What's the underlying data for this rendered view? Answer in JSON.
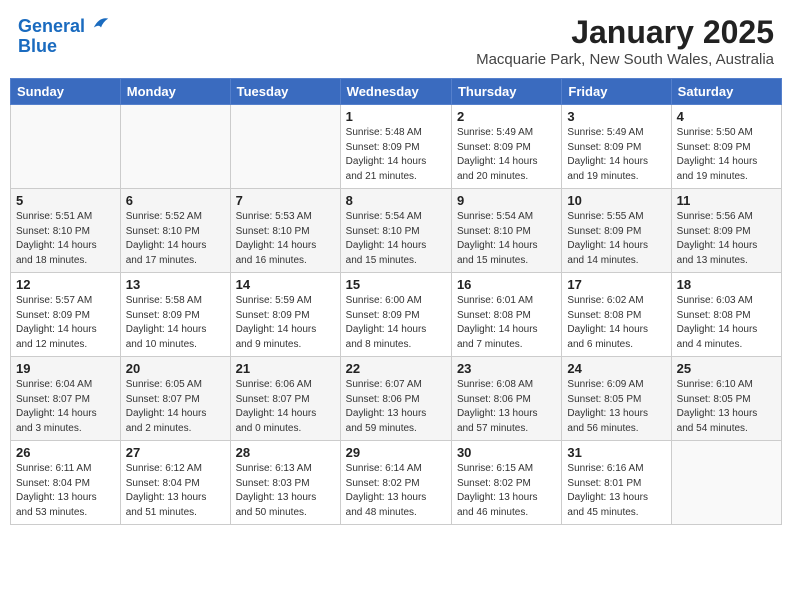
{
  "header": {
    "logo_line1": "General",
    "logo_line2": "Blue",
    "month": "January 2025",
    "location": "Macquarie Park, New South Wales, Australia"
  },
  "weekdays": [
    "Sunday",
    "Monday",
    "Tuesday",
    "Wednesday",
    "Thursday",
    "Friday",
    "Saturday"
  ],
  "weeks": [
    [
      {
        "day": "",
        "info": ""
      },
      {
        "day": "",
        "info": ""
      },
      {
        "day": "",
        "info": ""
      },
      {
        "day": "1",
        "info": "Sunrise: 5:48 AM\nSunset: 8:09 PM\nDaylight: 14 hours\nand 21 minutes."
      },
      {
        "day": "2",
        "info": "Sunrise: 5:49 AM\nSunset: 8:09 PM\nDaylight: 14 hours\nand 20 minutes."
      },
      {
        "day": "3",
        "info": "Sunrise: 5:49 AM\nSunset: 8:09 PM\nDaylight: 14 hours\nand 19 minutes."
      },
      {
        "day": "4",
        "info": "Sunrise: 5:50 AM\nSunset: 8:09 PM\nDaylight: 14 hours\nand 19 minutes."
      }
    ],
    [
      {
        "day": "5",
        "info": "Sunrise: 5:51 AM\nSunset: 8:10 PM\nDaylight: 14 hours\nand 18 minutes."
      },
      {
        "day": "6",
        "info": "Sunrise: 5:52 AM\nSunset: 8:10 PM\nDaylight: 14 hours\nand 17 minutes."
      },
      {
        "day": "7",
        "info": "Sunrise: 5:53 AM\nSunset: 8:10 PM\nDaylight: 14 hours\nand 16 minutes."
      },
      {
        "day": "8",
        "info": "Sunrise: 5:54 AM\nSunset: 8:10 PM\nDaylight: 14 hours\nand 15 minutes."
      },
      {
        "day": "9",
        "info": "Sunrise: 5:54 AM\nSunset: 8:10 PM\nDaylight: 14 hours\nand 15 minutes."
      },
      {
        "day": "10",
        "info": "Sunrise: 5:55 AM\nSunset: 8:09 PM\nDaylight: 14 hours\nand 14 minutes."
      },
      {
        "day": "11",
        "info": "Sunrise: 5:56 AM\nSunset: 8:09 PM\nDaylight: 14 hours\nand 13 minutes."
      }
    ],
    [
      {
        "day": "12",
        "info": "Sunrise: 5:57 AM\nSunset: 8:09 PM\nDaylight: 14 hours\nand 12 minutes."
      },
      {
        "day": "13",
        "info": "Sunrise: 5:58 AM\nSunset: 8:09 PM\nDaylight: 14 hours\nand 10 minutes."
      },
      {
        "day": "14",
        "info": "Sunrise: 5:59 AM\nSunset: 8:09 PM\nDaylight: 14 hours\nand 9 minutes."
      },
      {
        "day": "15",
        "info": "Sunrise: 6:00 AM\nSunset: 8:09 PM\nDaylight: 14 hours\nand 8 minutes."
      },
      {
        "day": "16",
        "info": "Sunrise: 6:01 AM\nSunset: 8:08 PM\nDaylight: 14 hours\nand 7 minutes."
      },
      {
        "day": "17",
        "info": "Sunrise: 6:02 AM\nSunset: 8:08 PM\nDaylight: 14 hours\nand 6 minutes."
      },
      {
        "day": "18",
        "info": "Sunrise: 6:03 AM\nSunset: 8:08 PM\nDaylight: 14 hours\nand 4 minutes."
      }
    ],
    [
      {
        "day": "19",
        "info": "Sunrise: 6:04 AM\nSunset: 8:07 PM\nDaylight: 14 hours\nand 3 minutes."
      },
      {
        "day": "20",
        "info": "Sunrise: 6:05 AM\nSunset: 8:07 PM\nDaylight: 14 hours\nand 2 minutes."
      },
      {
        "day": "21",
        "info": "Sunrise: 6:06 AM\nSunset: 8:07 PM\nDaylight: 14 hours\nand 0 minutes."
      },
      {
        "day": "22",
        "info": "Sunrise: 6:07 AM\nSunset: 8:06 PM\nDaylight: 13 hours\nand 59 minutes."
      },
      {
        "day": "23",
        "info": "Sunrise: 6:08 AM\nSunset: 8:06 PM\nDaylight: 13 hours\nand 57 minutes."
      },
      {
        "day": "24",
        "info": "Sunrise: 6:09 AM\nSunset: 8:05 PM\nDaylight: 13 hours\nand 56 minutes."
      },
      {
        "day": "25",
        "info": "Sunrise: 6:10 AM\nSunset: 8:05 PM\nDaylight: 13 hours\nand 54 minutes."
      }
    ],
    [
      {
        "day": "26",
        "info": "Sunrise: 6:11 AM\nSunset: 8:04 PM\nDaylight: 13 hours\nand 53 minutes."
      },
      {
        "day": "27",
        "info": "Sunrise: 6:12 AM\nSunset: 8:04 PM\nDaylight: 13 hours\nand 51 minutes."
      },
      {
        "day": "28",
        "info": "Sunrise: 6:13 AM\nSunset: 8:03 PM\nDaylight: 13 hours\nand 50 minutes."
      },
      {
        "day": "29",
        "info": "Sunrise: 6:14 AM\nSunset: 8:02 PM\nDaylight: 13 hours\nand 48 minutes."
      },
      {
        "day": "30",
        "info": "Sunrise: 6:15 AM\nSunset: 8:02 PM\nDaylight: 13 hours\nand 46 minutes."
      },
      {
        "day": "31",
        "info": "Sunrise: 6:16 AM\nSunset: 8:01 PM\nDaylight: 13 hours\nand 45 minutes."
      },
      {
        "day": "",
        "info": ""
      }
    ]
  ]
}
